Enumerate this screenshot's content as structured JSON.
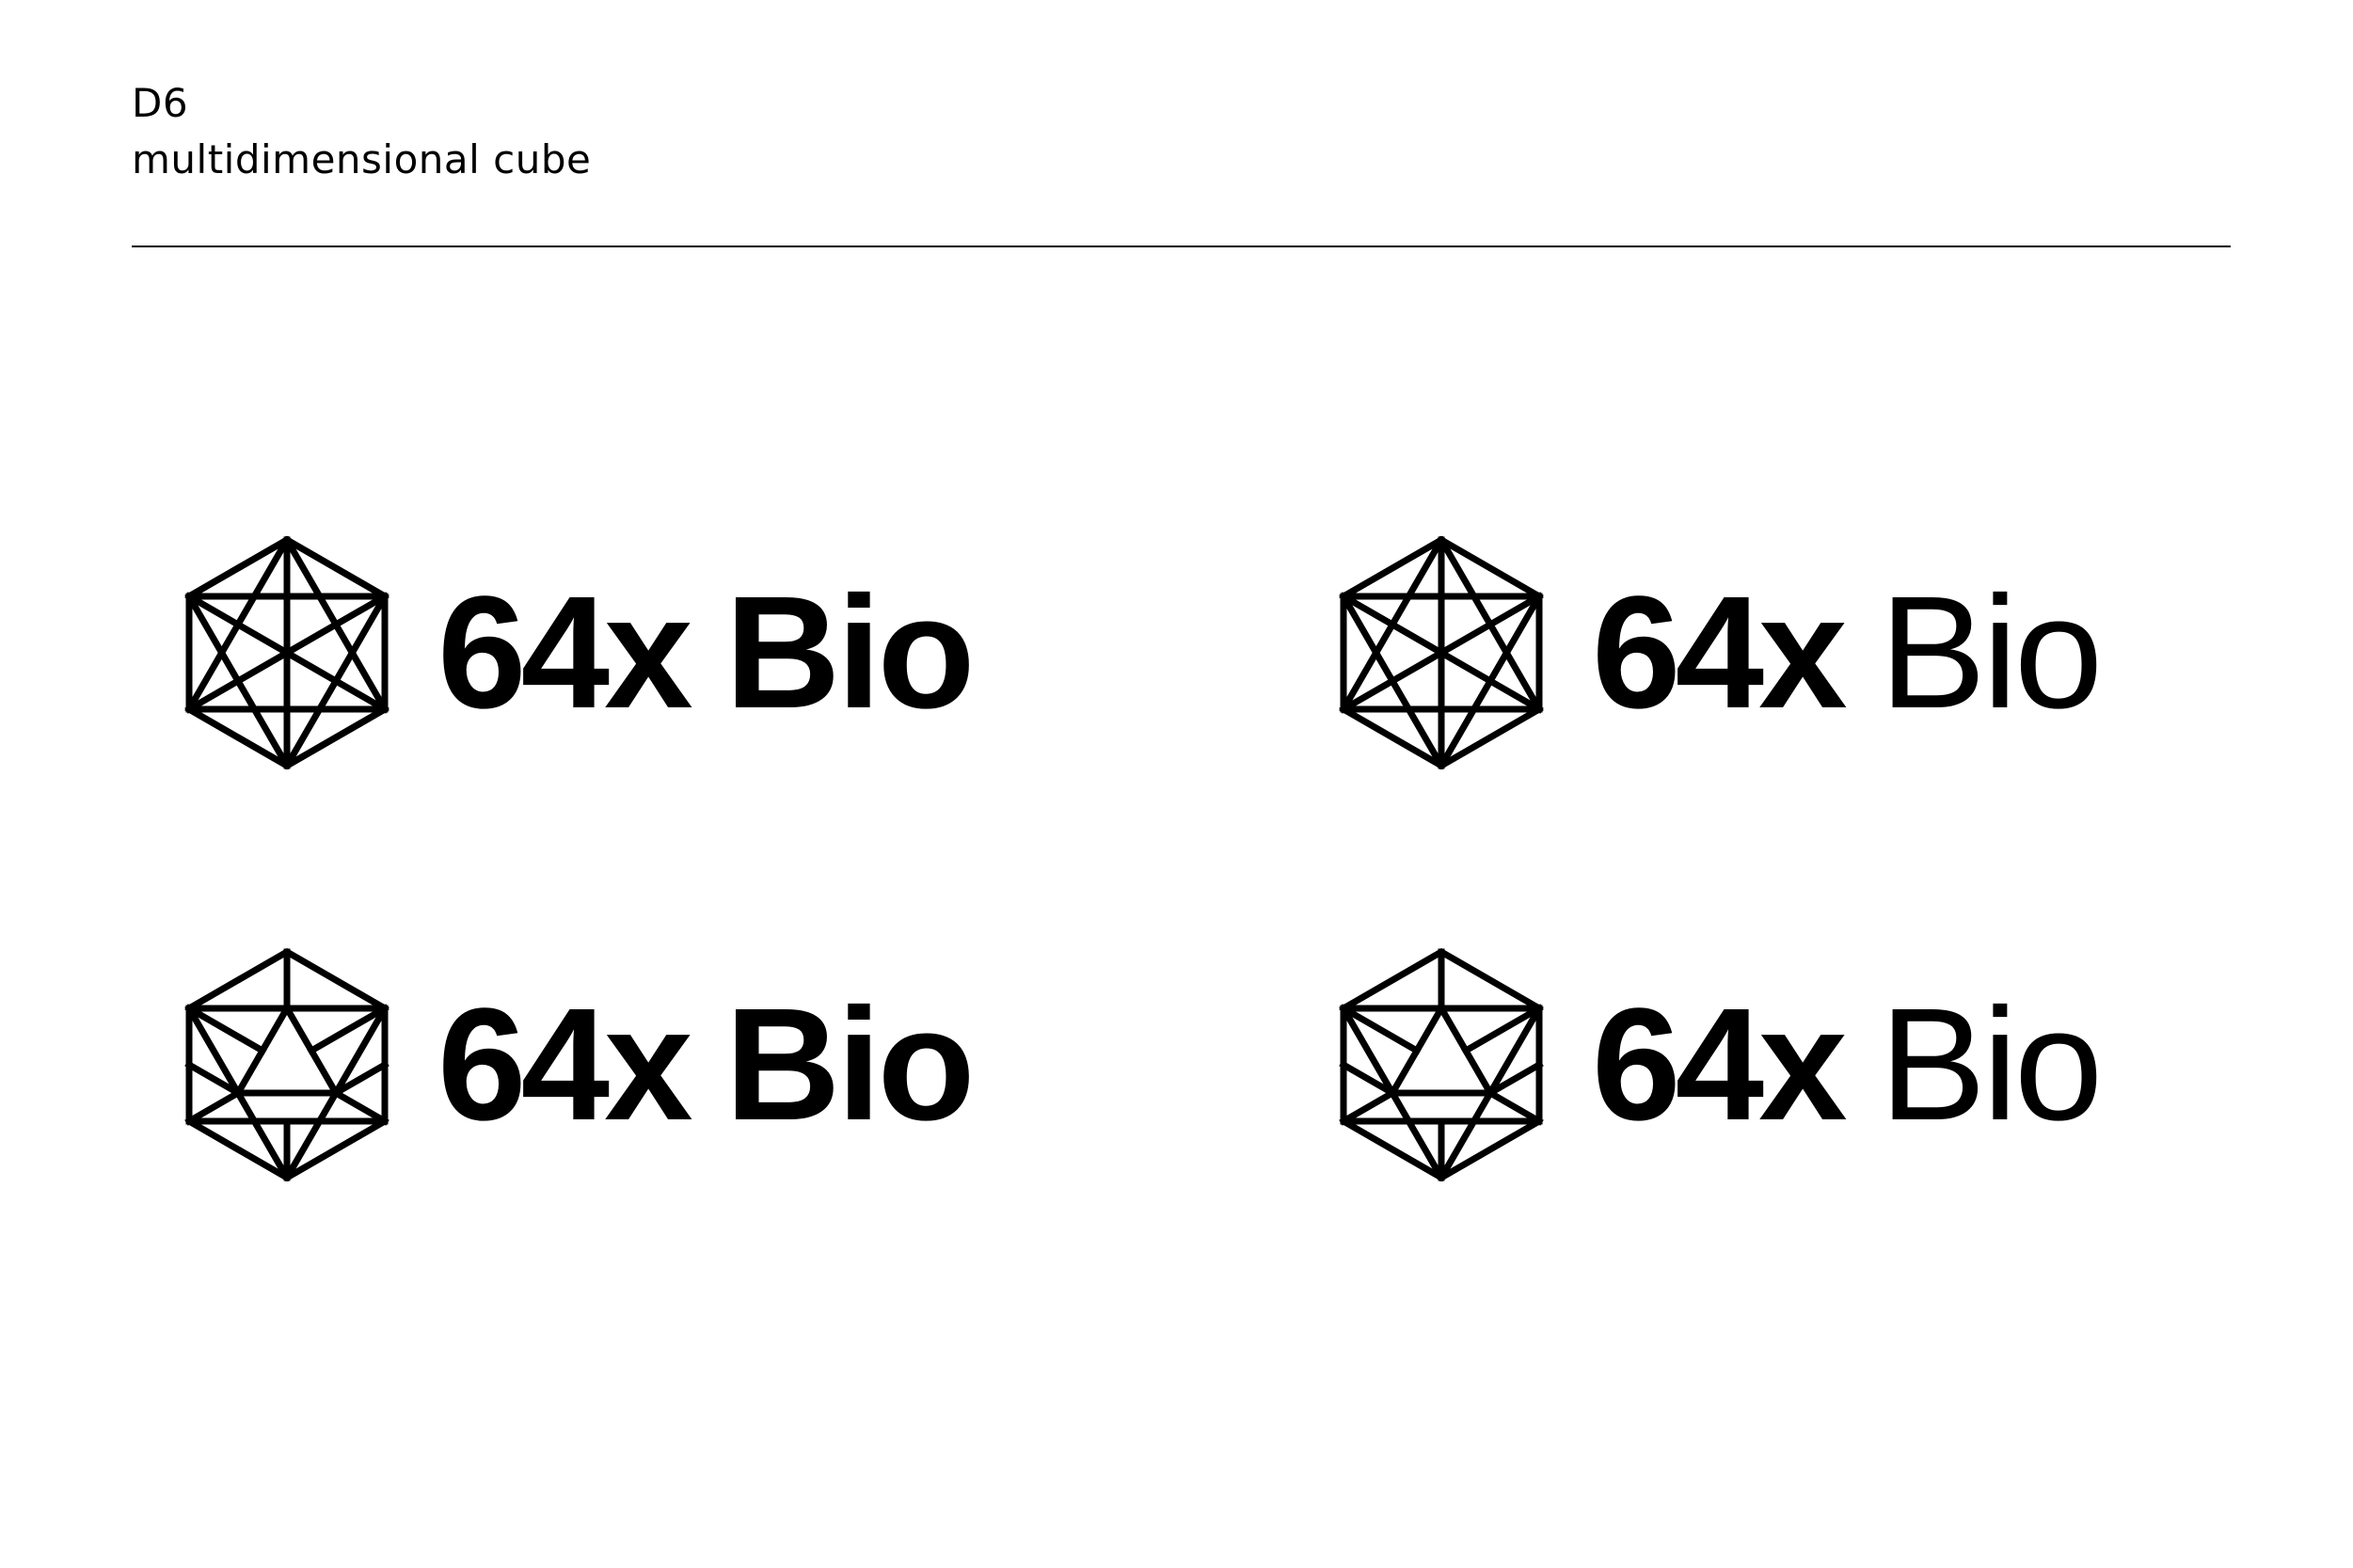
{
  "header": {
    "code": "D6",
    "title": "multidimensional cube"
  },
  "logos": [
    {
      "mark": "cube-star-mark",
      "number": "64x",
      "word": "Bio",
      "word_weight": "bold"
    },
    {
      "mark": "cube-star-mark",
      "number": "64x",
      "word": "Bio",
      "word_weight": "light"
    },
    {
      "mark": "cube-triangle-mark",
      "number": "64x",
      "word": "Bio",
      "word_weight": "bold"
    },
    {
      "mark": "cube-triangle-mark",
      "number": "64x",
      "word": "Bio",
      "word_weight": "light"
    }
  ],
  "colors": {
    "background": "#ffffff",
    "ink": "#000000"
  }
}
